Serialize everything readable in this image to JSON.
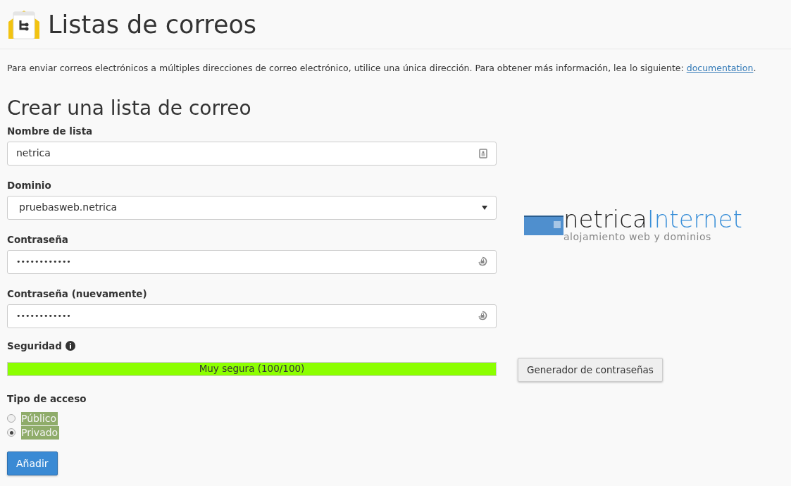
{
  "page_title": "Listas de correos",
  "intro": {
    "text": "Para enviar correos electrónicos a múltiples direcciones de correo electrónico, utilice una única dirección. Para obtener más información, lea lo siguiente:",
    "link": "documentation",
    "after": "."
  },
  "form": {
    "title": "Crear una lista de correo",
    "fields": [
      {
        "kind": "text",
        "label": "Nombre de lista",
        "value": "netrica"
      },
      {
        "kind": "select",
        "label": "Dominio",
        "value": "pruebasweb.netrica"
      },
      {
        "kind": "password",
        "label": "Contraseña",
        "value": "••••••••••••"
      },
      {
        "kind": "password",
        "label": "Contraseña (nuevamente)",
        "value": "••••••••••••"
      }
    ],
    "strength": {
      "label": "Seguridad",
      "reading": "Muy segura (100/100)",
      "level": 1
    },
    "generator_button": "Generador de contraseñas",
    "access": {
      "label": "Tipo de acceso",
      "options": [
        {
          "label": "Público",
          "selected": false
        },
        {
          "label": "Privado",
          "selected": true
        }
      ]
    },
    "submit": "Añadir"
  },
  "logo": {
    "name_dark": "netrica",
    "name_light": "Internet",
    "tagline": "alojamiento web y dominios"
  }
}
